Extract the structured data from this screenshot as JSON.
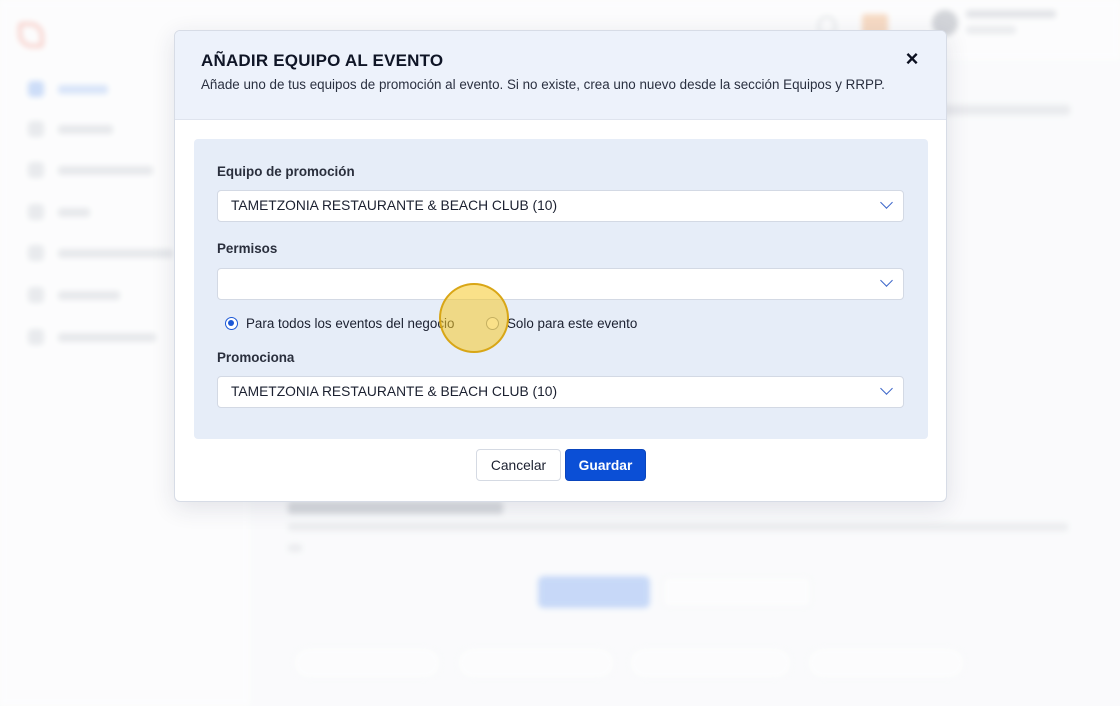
{
  "modal": {
    "title": "AÑADIR EQUIPO AL EVENTO",
    "subtitle": "Añade uno de tus equipos de promoción al evento. Si no existe, crea uno nuevo desde la sección Equipos y RRPP.",
    "close_icon": "×",
    "fields": {
      "team": {
        "label": "Equipo de promoción",
        "value": "TAMETZONIA RESTAURANTE & BEACH CLUB (10)"
      },
      "permissions": {
        "label": "Permisos",
        "value": ""
      },
      "scope": {
        "options": [
          {
            "label": "Para todos los eventos del negocio",
            "selected": true
          },
          {
            "label": "Solo para este evento",
            "selected": false
          }
        ]
      },
      "promotes": {
        "label": "Promociona",
        "value": "TAMETZONIA RESTAURANTE & BEACH CLUB (10)"
      }
    },
    "buttons": {
      "cancel": "Cancelar",
      "save": "Guardar"
    }
  },
  "theme": {
    "primary": "#0b4fd6",
    "header_bg": "#edf2fb",
    "panel_bg": "#e6edf8",
    "click_highlight": "#f5c828"
  },
  "icons": {
    "close": "close-icon",
    "dropdown": "chevron-down-icon",
    "radio": "radio-icon"
  }
}
